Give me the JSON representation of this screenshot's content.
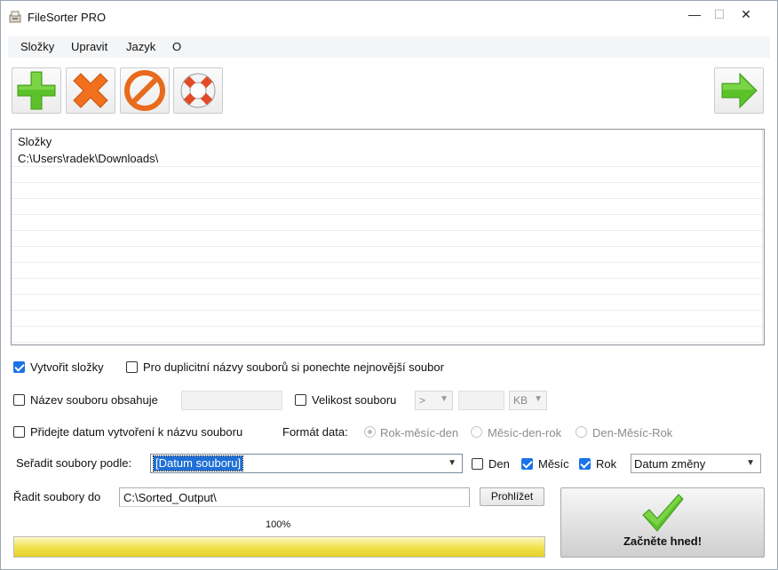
{
  "window": {
    "title": "FileSorter PRO",
    "minimize": "—",
    "maximize": "☐",
    "close": "✕"
  },
  "menu": {
    "items": [
      "Složky",
      "Upravit",
      "Jazyk",
      "O"
    ]
  },
  "toolbar": {
    "icons": [
      "plus-icon",
      "x-icon",
      "no-entry-icon",
      "lifebuoy-icon",
      "arrow-right-icon"
    ],
    "colors": {
      "green": "#5cc22a",
      "orange": "#f0701e",
      "red": "#e34b27"
    }
  },
  "list": {
    "header": "Složky",
    "rows": [
      "C:\\Users\\radek\\Downloads\\"
    ]
  },
  "options": {
    "create_folders": {
      "label": "Vytvořit složky",
      "checked": true
    },
    "keep_newest": {
      "label": "Pro duplicitní názvy souborů si ponechte nejnovější soubor",
      "checked": false
    },
    "name_contains": {
      "label": "Název souboru obsahuje",
      "checked": false,
      "value": ""
    },
    "file_size": {
      "label": "Velikost souboru",
      "checked": false,
      "operator": ">",
      "value": "",
      "unit": "KB"
    },
    "add_date": {
      "label": "Přidejte datum vytvoření k názvu souboru",
      "checked": false
    },
    "date_format": {
      "label": "Formát data:",
      "choices": [
        "Rok-měsíc-den",
        "Měsíc-den-rok",
        "Den-Měsíc-Rok"
      ],
      "selected": "Rok-měsíc-den"
    }
  },
  "sort": {
    "label": "Seřadit soubory podle:",
    "selected": "[Datum souboru]",
    "day": {
      "label": "Den",
      "checked": false
    },
    "month": {
      "label": "Měsíc",
      "checked": true
    },
    "year": {
      "label": "Rok",
      "checked": true
    },
    "date_type": "Datum změny"
  },
  "output": {
    "label": "Řadit soubory do",
    "path": "C:\\Sorted_Output\\",
    "browse": "Prohlížet"
  },
  "progress": {
    "label": "100%",
    "value": 100
  },
  "start": {
    "label": "Začněte hned!"
  }
}
